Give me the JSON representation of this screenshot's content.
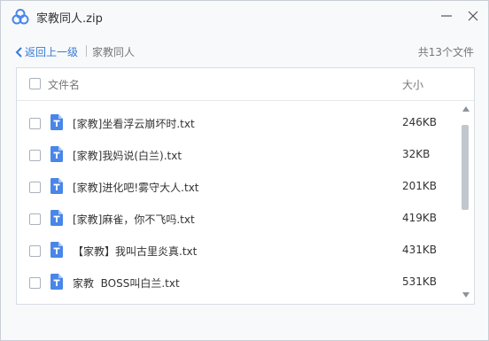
{
  "window": {
    "title": "家教同人.zip",
    "accent_color": "#3a7bd5"
  },
  "nav": {
    "back_label": "返回上一级",
    "breadcrumb": "家教同人",
    "file_count": "共13个文件"
  },
  "list": {
    "col_name": "文件名",
    "col_size": "大小",
    "files": [
      {
        "name": "[家教]坐看浮云崩坏时.txt",
        "size": "246KB",
        "icon": "txt-file-icon"
      },
      {
        "name": "[家教]我妈说(白兰).txt",
        "size": "32KB",
        "icon": "txt-file-icon"
      },
      {
        "name": "[家教]进化吧!雾守大人.txt",
        "size": "201KB",
        "icon": "txt-file-icon"
      },
      {
        "name": "[家教]麻雀，你不飞吗.txt",
        "size": "419KB",
        "icon": "txt-file-icon"
      },
      {
        "name": "【家教】我叫古里炎真.txt",
        "size": "431KB",
        "icon": "txt-file-icon"
      },
      {
        "name": "家教  BOSS叫白兰.txt",
        "size": "531KB",
        "icon": "txt-file-icon"
      }
    ]
  }
}
